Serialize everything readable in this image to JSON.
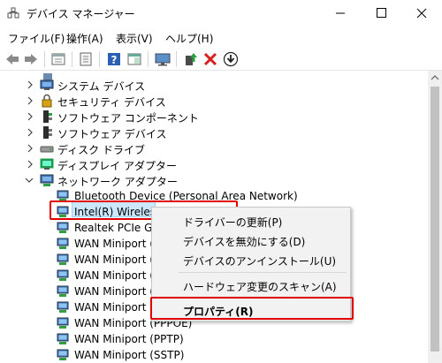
{
  "window": {
    "title": "デバイス マネージャー",
    "colors": {
      "accent": "#0078d7",
      "highlight": "#e00000",
      "selection": "#cce8ff"
    }
  },
  "menu": {
    "items": [
      "ファイル(F)",
      "操作(A)",
      "表示(V)",
      "ヘルプ(H)"
    ]
  },
  "toolbar": {
    "icons": [
      "back-icon",
      "forward-icon",
      "properties-pane-icon",
      "device-info-icon",
      "help-icon",
      "action-pane-icon",
      "monitor-icon",
      "update-driver-icon",
      "uninstall-icon",
      "download-icon"
    ]
  },
  "tree": {
    "categories": [
      {
        "label": "システム デバイス",
        "icon": "system-devices-icon"
      },
      {
        "label": "セキュリティ デバイス",
        "icon": "security-devices-icon"
      },
      {
        "label": "ソフトウェア コンポーネント",
        "icon": "software-component-icon"
      },
      {
        "label": "ソフトウェア デバイス",
        "icon": "software-device-icon"
      },
      {
        "label": "ディスク ドライブ",
        "icon": "disk-drive-icon"
      },
      {
        "label": "ディスプレイ アダプター",
        "icon": "display-adapter-icon"
      },
      {
        "label": "ネットワーク アダプター",
        "icon": "network-adapter-icon",
        "expanded": true
      }
    ],
    "network_devices": [
      {
        "label": "Bluetooth Device (Personal Area Network)"
      },
      {
        "label": "Intel(R) Wireless-",
        "selected": true
      },
      {
        "label": "Realtek PCIe GbE"
      },
      {
        "label": "WAN Miniport (I"
      },
      {
        "label": "WAN Miniport (I"
      },
      {
        "label": "WAN Miniport (I"
      },
      {
        "label": "WAN Miniport (L"
      },
      {
        "label": "WAN Miniport (I"
      },
      {
        "label": "WAN Miniport (PPPOE)"
      },
      {
        "label": "WAN Miniport (PPTP)"
      },
      {
        "label": "WAN Miniport (SSTP)"
      }
    ]
  },
  "context_menu": {
    "items": [
      {
        "label": "ドライバーの更新(P)"
      },
      {
        "label": "デバイスを無効にする(D)"
      },
      {
        "label": "デバイスのアンインストール(U)"
      },
      {
        "label": "ハードウェア変更のスキャン(A)"
      },
      {
        "label": "プロパティ(R)",
        "bold": true
      }
    ]
  }
}
